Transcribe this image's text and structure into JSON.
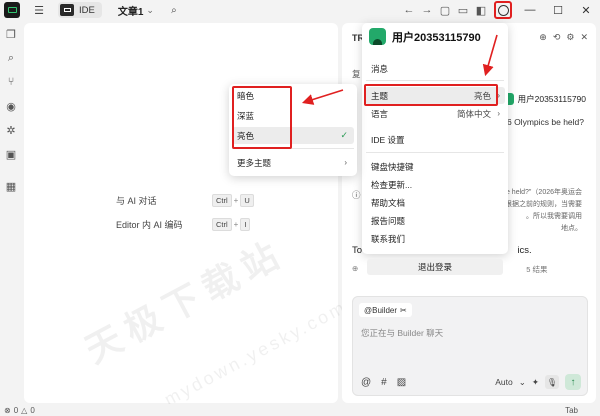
{
  "titlebar": {
    "mode_label": "IDE",
    "doc_name": "文章1",
    "doc_chevron": "⌄",
    "menu_icon": "menu-icon",
    "search_icon": "search-icon"
  },
  "editor": {
    "shortcuts": [
      {
        "label": "与 AI 对话",
        "keys": [
          "Ctrl",
          "U"
        ]
      },
      {
        "label": "Editor 内 AI 编码",
        "keys": [
          "Ctrl",
          "I"
        ]
      }
    ]
  },
  "chat": {
    "header": "TR",
    "line_fu": "复",
    "user_name": "用户20353115790",
    "question_tail": "6 Olympics be held?",
    "note_lines": [
      "be held?\"（2026年奥运会",
      "根据之前的规则，当需要",
      "。所以我需要调用",
      "地点。"
    ],
    "note_prefix": "搜",
    "answer_prefix": "To",
    "answer_tail": "ics.",
    "result_count": "5 结果",
    "builder": {
      "tag": "@Builder",
      "placeholder": "您正在与 Builder 聊天",
      "model": "Auto"
    }
  },
  "account_menu": {
    "user_name": "用户20353115790",
    "items": [
      {
        "label": "消息"
      },
      {
        "label": "主题",
        "value": "亮色",
        "submenu": true
      },
      {
        "label": "语言",
        "value": "简体中文",
        "submenu": true
      },
      {
        "label": "IDE 设置"
      },
      {
        "label": "键盘快捷键"
      },
      {
        "label": "检查更新..."
      },
      {
        "label": "帮助文档"
      },
      {
        "label": "报告问题"
      },
      {
        "label": "联系我们"
      }
    ],
    "logout": "退出登录"
  },
  "theme_menu": {
    "items": [
      {
        "label": "暗色"
      },
      {
        "label": "深蓝"
      },
      {
        "label": "亮色",
        "selected": true
      }
    ],
    "more": "更多主题"
  },
  "statusbar": {
    "errors": "0",
    "warnings": "0",
    "right_text": "Tab"
  },
  "watermark": {
    "text": "天极下载站",
    "url": "mydown.yesky.com"
  },
  "colors": {
    "accent_green": "#23a96a",
    "highlight_red": "#e02020"
  }
}
